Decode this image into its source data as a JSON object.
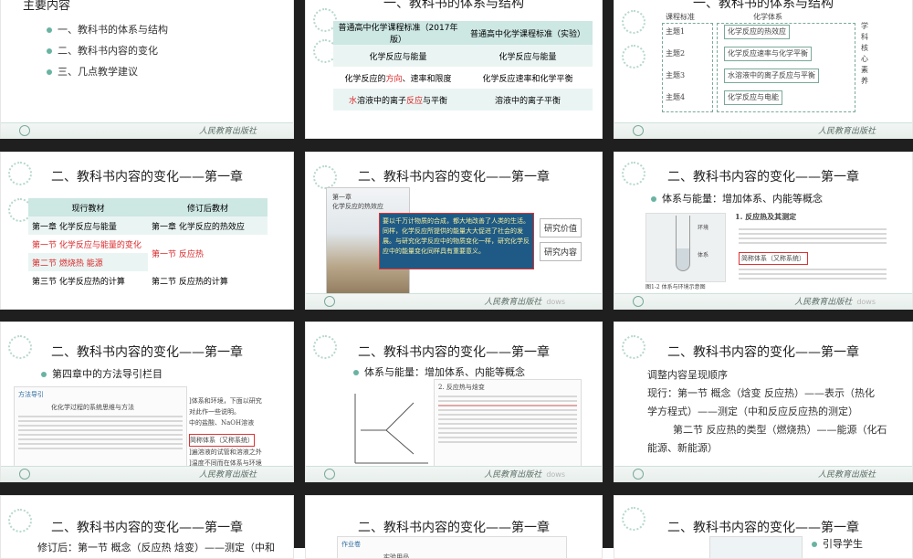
{
  "publisher_logo_text": "人民教育出版社",
  "watermark": "dows",
  "slides": {
    "s1": {
      "partial_title": "主要内容",
      "items": [
        "一、教科书的体系与结构",
        "二、教科书内容的变化",
        "三、几点教学建议"
      ]
    },
    "s2": {
      "title": "一、教科书的体系与结构",
      "headers": [
        "普通高中化学课程标准（2017年版）",
        "普通高中化学课程标准（实验）"
      ],
      "rows": [
        [
          "化学反应与能量",
          "化学反应与能量"
        ],
        [
          "化学反应的方向、速率和限度",
          "化学反应速率和化学平衡"
        ],
        [
          "水溶液中的离子反应与平衡",
          "溶液中的离子平衡"
        ]
      ],
      "row2_red": "方向",
      "row3_red_a": "水",
      "row3_red_b": "反应"
    },
    "s3": {
      "title": "一、教科书的体系与结构",
      "labels": [
        "课程标准",
        "化学体系",
        "学科核心素养"
      ],
      "themes": [
        "主题1",
        "主题2",
        "主题3",
        "主题4"
      ],
      "boxes": [
        "化学反应的热效应",
        "化学反应速率与化学平衡",
        "水溶液中的离子反应与平衡",
        "化学反应与电能"
      ]
    },
    "s4": {
      "title": "二、教科书内容的变化——第一章",
      "headers": [
        "现行教材",
        "修订后教材"
      ],
      "left": [
        "第一章  化学反应与能量",
        "第一节  化学反应与能量的变化",
        "第二节  燃烧热  能源",
        "第三节  化学反应热的计算"
      ],
      "right": [
        "第一章  化学反应的热效应",
        "第一节  反应热",
        "第二节  反应热的计算"
      ]
    },
    "s5": {
      "title": "二、教科书内容的变化——第一章",
      "chapter_label": "第一章",
      "chapter_sub": "化学反应的热效应",
      "highlight_text": "要以千万计物质的合成，都大地改善了人类的生活。同样，化学反应所提供的能量大大促进了社会的发展。与研究化学反应中的物质变化一样，研究化学反应中的能量变化同样具有重要意义。",
      "tags": [
        "研究价值",
        "研究内容"
      ]
    },
    "s6": {
      "title": "二、教科书内容的变化——第一章",
      "subtitle": "体系与能量：增加体系、内能等概念",
      "section": "1. 反应热及其测定",
      "caption": "图1-2  体系与环境示意图",
      "boxed": "简称体系（又称系统）",
      "labels": [
        "环境",
        "体系"
      ]
    },
    "s7": {
      "title": "二、教科书内容的变化——第一章",
      "subtitle": "第四章中的方法导引栏目",
      "header": "方法导引",
      "inner_title": "化化学过程的系统思维与方法",
      "frag": [
        "]体系和环境，下面以研究",
        "对此作一些说明。",
        "中的盐酸、NaOH溶液",
        "简称体系（又称系统）",
        "]遍溶液的试管和溶液之外",
        "]温度不同而在体系与环境"
      ]
    },
    "s8": {
      "title": "二、教科书内容的变化——第一章",
      "subtitle": "体系与能量：增加体系、内能等概念",
      "section": "2. 反应热与焓变",
      "labels": [
        "新方法",
        "能量变化",
        "反应热"
      ]
    },
    "s9": {
      "title": "二、教科书内容的变化——第一章",
      "lines": [
        "调整内容呈现顺序",
        "现行：第一节  概念（焓变 反应热）——表示（热化",
        "学方程式）——测定（中和反应反应热的测定）",
        "        第二节 反应热的类型（燃烧热）——能源（化石",
        "能源、新能源）"
      ]
    },
    "s10": {
      "title": "二、教科书内容的变化——第一章",
      "line": "修订后：第一节  概念（反应热 焓变）——测定（中和"
    },
    "s11": {
      "title": "二、教科书内容的变化——第一章",
      "box_header": "作业卷",
      "box_sub": "实验用品"
    },
    "s12": {
      "title": "二、教科书内容的变化——第一章",
      "bullet": "引导学生"
    }
  }
}
